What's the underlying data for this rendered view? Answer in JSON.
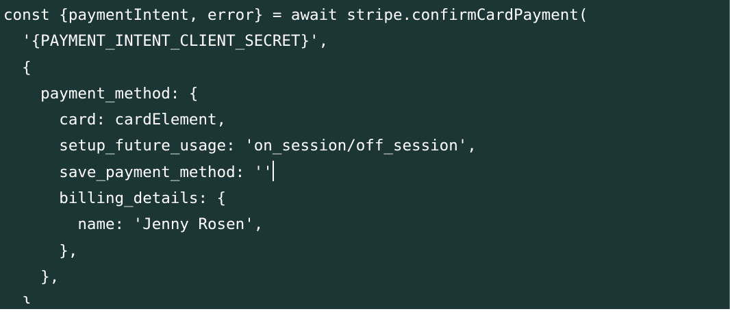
{
  "code_editor": {
    "lines": [
      "const {paymentIntent, error} = await stripe.confirmCardPayment(",
      "  '{PAYMENT_INTENT_CLIENT_SECRET}',",
      "  {",
      "    payment_method: {",
      "      card: cardElement,",
      "      setup_future_usage: 'on_session/off_session',",
      "      save_payment_method: ''",
      "      billing_details: {",
      "        name: 'Jenny Rosen',",
      "      },",
      "    },",
      "  }"
    ]
  },
  "colors": {
    "background": "#1b3634",
    "text": "#ffffff"
  }
}
